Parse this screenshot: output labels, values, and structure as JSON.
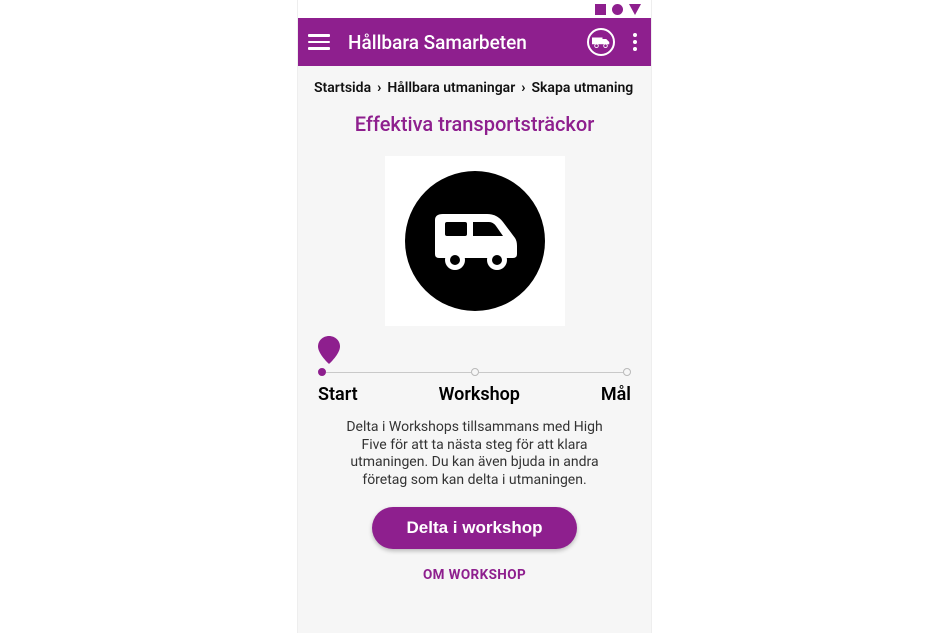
{
  "app_bar": {
    "title": "Hållbara Samarbeten"
  },
  "breadcrumb": {
    "items": [
      "Startsida",
      "Hållbara utmaningar",
      "Skapa utmaning"
    ]
  },
  "page": {
    "title": "Effektiva transportsträckor"
  },
  "stepper": {
    "labels": {
      "start": "Start",
      "mid": "Workshop",
      "end": "Mål"
    }
  },
  "desc": "Delta i Workshops tillsammans med High Five för att ta nästa steg för att klara utmaningen. Du kan även bjuda in andra företag som kan delta i utmaningen.",
  "cta": {
    "label": "Delta i workshop"
  },
  "link": {
    "label": "OM WORKSHOP"
  }
}
